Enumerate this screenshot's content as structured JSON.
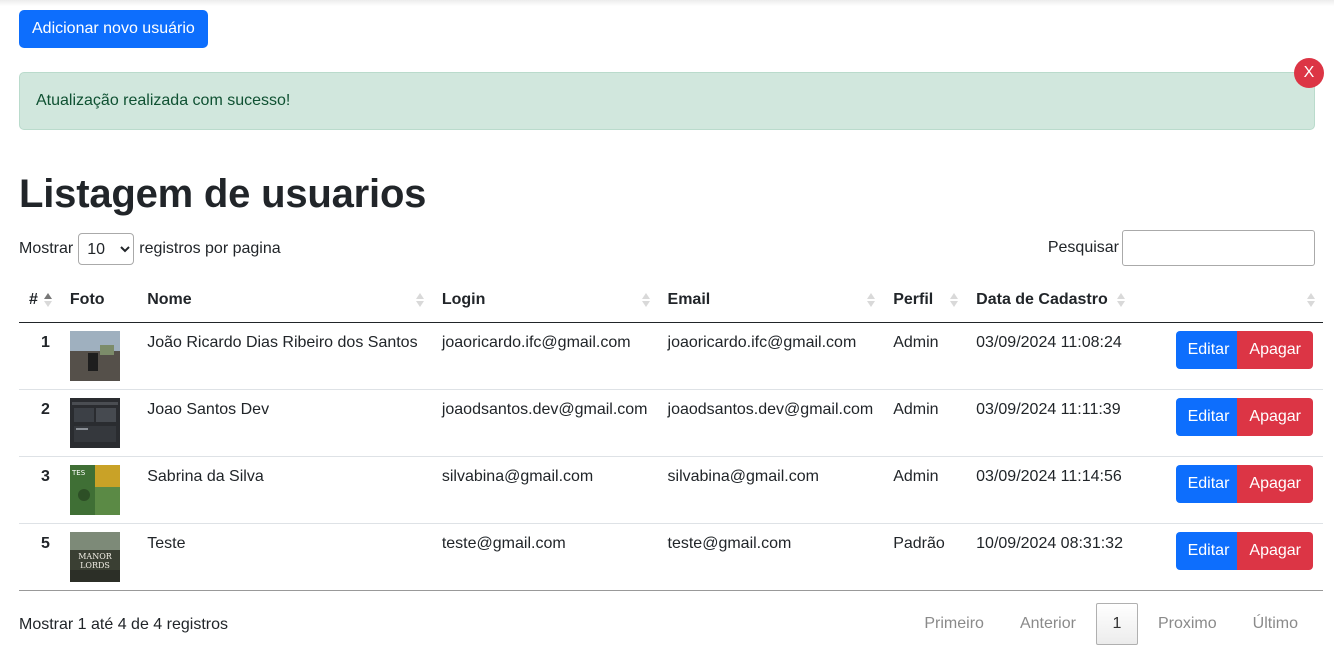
{
  "toolbar": {
    "add_label": "Adicionar novo usuário"
  },
  "alert": {
    "message": "Atualização realizada com sucesso!",
    "close_label": "X"
  },
  "page": {
    "title": "Listagem de usuarios"
  },
  "length": {
    "prefix": "Mostrar",
    "selected": "10",
    "suffix": "registros por pagina"
  },
  "search": {
    "label": "Pesquisar",
    "value": ""
  },
  "table": {
    "headers": [
      "#",
      "Foto",
      "Nome",
      "Login",
      "Email",
      "Perfil",
      "Data de Cadastro",
      ""
    ],
    "rows": [
      {
        "id": "1",
        "nome": "João Ricardo Dias Ribeiro dos Santos",
        "login": "joaoricardo.ifc@gmail.com",
        "email": "joaoricardo.ifc@gmail.com",
        "perfil": "Admin",
        "data": "03/09/2024 11:08:24"
      },
      {
        "id": "2",
        "nome": "Joao Santos Dev",
        "login": "joaodsantos.dev@gmail.com",
        "email": "joaodsantos.dev@gmail.com",
        "perfil": "Admin",
        "data": "03/09/2024 11:11:39"
      },
      {
        "id": "3",
        "nome": "Sabrina da Silva",
        "login": "silvabina@gmail.com",
        "email": "silvabina@gmail.com",
        "perfil": "Admin",
        "data": "03/09/2024 11:14:56"
      },
      {
        "id": "5",
        "nome": "Teste",
        "login": "teste@gmail.com",
        "email": "teste@gmail.com",
        "perfil": "Padrão",
        "data": "10/09/2024 08:31:32"
      }
    ],
    "edit_label": "Editar",
    "delete_label": "Apagar"
  },
  "thumb_texts": {
    "t3_a": "TES",
    "t5_a": "MANOR",
    "t5_b": "LORDS"
  },
  "footer": {
    "info": "Mostrar 1 até 4 de 4 registros"
  },
  "pagination": {
    "first": "Primeiro",
    "prev": "Anterior",
    "current": "1",
    "next": "Proximo",
    "last": "Último"
  },
  "colors": {
    "primary": "#0d6efd",
    "danger": "#dc3545",
    "success_bg": "#d1e7dd",
    "success_text": "#0f5132"
  }
}
